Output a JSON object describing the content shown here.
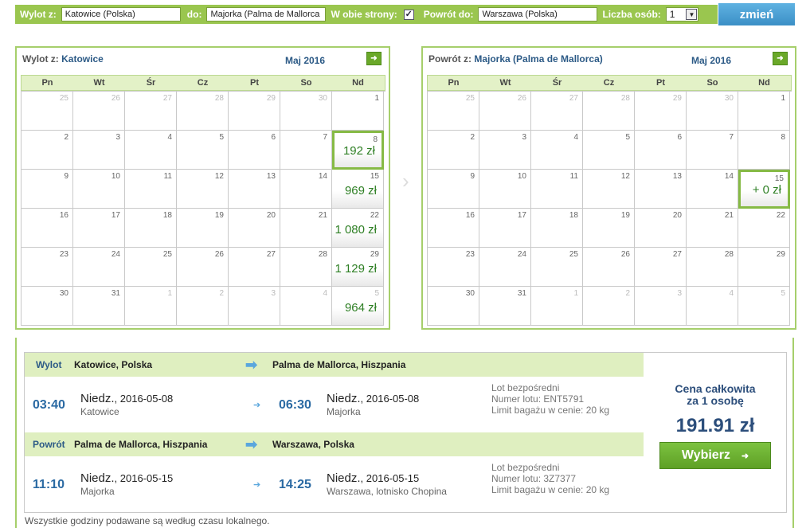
{
  "search": {
    "from_label": "Wylot z:",
    "from_value": "Katowice (Polska)",
    "to_label": "do:",
    "to_value": "Majorka (Palma de Mallorca",
    "both_label": "W obie strony:",
    "both_checked": "✓",
    "return_label": "Powrót do:",
    "return_value": "Warszawa (Polska)",
    "persons_label": "Liczba osób:",
    "persons_value": "1",
    "submit": "zmień"
  },
  "weekdays": [
    "Pn",
    "Wt",
    "Śr",
    "Cz",
    "Pt",
    "So",
    "Nd"
  ],
  "outbound": {
    "title_prefix": "Wylot z:",
    "title_city": "Katowice",
    "month": "Maj 2016",
    "weeks": [
      [
        {
          "d": "25",
          "o": 1
        },
        {
          "d": "26",
          "o": 1
        },
        {
          "d": "27",
          "o": 1
        },
        {
          "d": "28",
          "o": 1
        },
        {
          "d": "29",
          "o": 1
        },
        {
          "d": "30",
          "o": 1
        },
        {
          "d": "1"
        }
      ],
      [
        {
          "d": "2"
        },
        {
          "d": "3"
        },
        {
          "d": "4"
        },
        {
          "d": "5"
        },
        {
          "d": "6"
        },
        {
          "d": "7"
        },
        {
          "d": "8",
          "p": "192 zł",
          "s": 1
        }
      ],
      [
        {
          "d": "9"
        },
        {
          "d": "10"
        },
        {
          "d": "11"
        },
        {
          "d": "12"
        },
        {
          "d": "13"
        },
        {
          "d": "14"
        },
        {
          "d": "15",
          "p": "969 zł"
        }
      ],
      [
        {
          "d": "16"
        },
        {
          "d": "17"
        },
        {
          "d": "18"
        },
        {
          "d": "19"
        },
        {
          "d": "20"
        },
        {
          "d": "21"
        },
        {
          "d": "22",
          "p": "1 080 zł"
        }
      ],
      [
        {
          "d": "23"
        },
        {
          "d": "24"
        },
        {
          "d": "25"
        },
        {
          "d": "26"
        },
        {
          "d": "27"
        },
        {
          "d": "28"
        },
        {
          "d": "29",
          "p": "1 129 zł"
        }
      ],
      [
        {
          "d": "30"
        },
        {
          "d": "31"
        },
        {
          "d": "1",
          "o": 1
        },
        {
          "d": "2",
          "o": 1
        },
        {
          "d": "3",
          "o": 1
        },
        {
          "d": "4",
          "o": 1
        },
        {
          "d": "5",
          "o": 1,
          "p": "964 zł"
        }
      ]
    ]
  },
  "inbound": {
    "title_prefix": "Powrót z:",
    "title_city": "Majorka (Palma de Mallorca)",
    "month": "Maj 2016",
    "weeks": [
      [
        {
          "d": "25",
          "o": 1
        },
        {
          "d": "26",
          "o": 1
        },
        {
          "d": "27",
          "o": 1
        },
        {
          "d": "28",
          "o": 1
        },
        {
          "d": "29",
          "o": 1
        },
        {
          "d": "30",
          "o": 1
        },
        {
          "d": "1"
        }
      ],
      [
        {
          "d": "2"
        },
        {
          "d": "3"
        },
        {
          "d": "4"
        },
        {
          "d": "5"
        },
        {
          "d": "6"
        },
        {
          "d": "7"
        },
        {
          "d": "8"
        }
      ],
      [
        {
          "d": "9"
        },
        {
          "d": "10"
        },
        {
          "d": "11"
        },
        {
          "d": "12"
        },
        {
          "d": "13"
        },
        {
          "d": "14"
        },
        {
          "d": "15",
          "p": "+ 0 zł",
          "s": 1
        }
      ],
      [
        {
          "d": "16"
        },
        {
          "d": "17"
        },
        {
          "d": "18"
        },
        {
          "d": "19"
        },
        {
          "d": "20"
        },
        {
          "d": "21"
        },
        {
          "d": "22"
        }
      ],
      [
        {
          "d": "23"
        },
        {
          "d": "24"
        },
        {
          "d": "25"
        },
        {
          "d": "26"
        },
        {
          "d": "27"
        },
        {
          "d": "28"
        },
        {
          "d": "29"
        }
      ],
      [
        {
          "d": "30"
        },
        {
          "d": "31"
        },
        {
          "d": "1",
          "o": 1
        },
        {
          "d": "2",
          "o": 1
        },
        {
          "d": "3",
          "o": 1
        },
        {
          "d": "4",
          "o": 1
        },
        {
          "d": "5",
          "o": 1
        }
      ]
    ]
  },
  "flight_out": {
    "label": "Wylot",
    "from": "Katowice, Polska",
    "to": "Palma de Mallorca, Hiszpania",
    "dep_time": "03:40",
    "dep_day": "Niedz.",
    "dep_date": ", 2016-05-08",
    "dep_city": "Katowice",
    "arr_time": "06:30",
    "arr_day": "Niedz.",
    "arr_date": ", 2016-05-08",
    "arr_city": "Majorka",
    "info1": "Lot bezpośredni",
    "info2": "Numer lotu: ENT5791",
    "info3": "Limit bagażu w cenie: 20 kg"
  },
  "flight_back": {
    "label": "Powrót",
    "from": "Palma de Mallorca, Hiszpania",
    "to": "Warszawa, Polska",
    "dep_time": "11:10",
    "dep_day": "Niedz.",
    "dep_date": ", 2016-05-15",
    "dep_city": "Majorka",
    "arr_time": "14:25",
    "arr_day": "Niedz.",
    "arr_date": ", 2016-05-15",
    "arr_city": "Warszawa, lotnisko Chopina",
    "info1": "Lot bezpośredni",
    "info2": "Numer lotu: 3Z7377",
    "info3": "Limit bagażu w cenie: 20 kg"
  },
  "price": {
    "line1": "Cena całkowita",
    "line2": "za 1 osobę",
    "total": "191.91 zł",
    "button": "Wybierz"
  },
  "footer": "Wszystkie godziny podawane są według czasu lokalnego."
}
